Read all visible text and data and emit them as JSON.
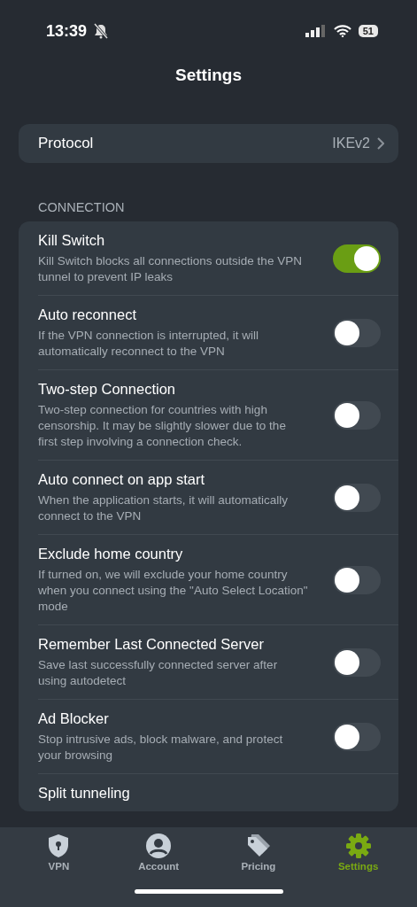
{
  "status_bar": {
    "time": "13:39",
    "battery": "51"
  },
  "title": "Settings",
  "protocol": {
    "label": "Protocol",
    "value": "IKEv2"
  },
  "section": "CONNECTION",
  "settings": [
    {
      "title": "Kill Switch",
      "description": "Kill Switch blocks all connections outside the VPN tunnel to prevent IP leaks",
      "on": true
    },
    {
      "title": "Auto reconnect",
      "description": "If the VPN connection is interrupted, it will automatically reconnect to the VPN",
      "on": false
    },
    {
      "title": "Two-step Connection",
      "description": "Two-step connection for countries with high censorship. It may be slightly slower due to the first step involving a connection check.",
      "on": false
    },
    {
      "title": "Auto connect on app start",
      "description": "When the application starts, it will automatically connect to the VPN",
      "on": false
    },
    {
      "title": "Exclude home country",
      "description": "If turned on, we will exclude your home country when you connect using the \"Auto Select Location\" mode",
      "on": false
    },
    {
      "title": "Remember Last Connected Server",
      "description": "Save last successfully connected server after using autodetect",
      "on": false
    },
    {
      "title": "Ad Blocker",
      "description": "Stop intrusive ads, block malware, and protect your browsing",
      "on": false
    },
    {
      "title": "Split tunneling"
    }
  ],
  "tabs": [
    {
      "label": "VPN",
      "kind": "shield",
      "selected": false
    },
    {
      "label": "Account",
      "kind": "person",
      "selected": false
    },
    {
      "label": "Pricing",
      "kind": "tag",
      "selected": false
    },
    {
      "label": "Settings",
      "kind": "gear",
      "selected": true
    }
  ]
}
